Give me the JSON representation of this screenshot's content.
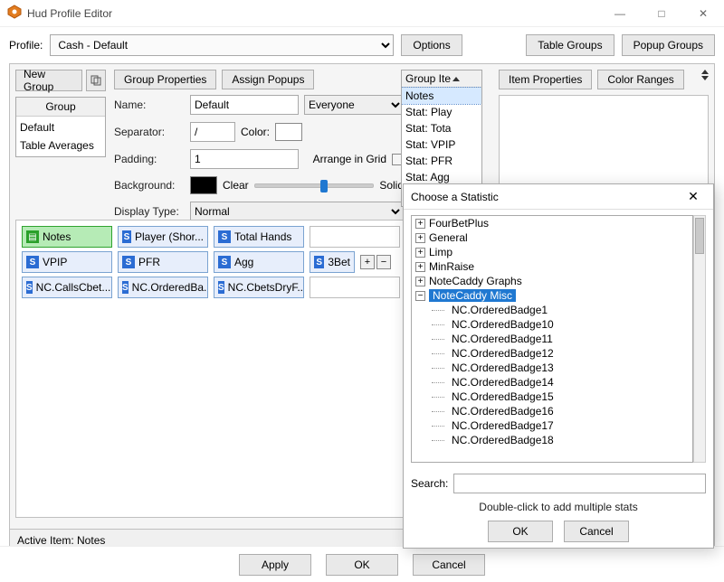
{
  "window": {
    "title": "Hud Profile Editor"
  },
  "profile": {
    "label": "Profile:",
    "selected": "Cash - Default",
    "options_btn": "Options",
    "table_groups": "Table Groups",
    "popup_groups": "Popup Groups"
  },
  "groups": {
    "new": "New Group",
    "header": "Group",
    "items": [
      "Default",
      "Table Averages"
    ]
  },
  "tabs": {
    "group_properties": "Group Properties",
    "assign_popups": "Assign Popups",
    "item_properties": "Item Properties",
    "color_ranges": "Color Ranges"
  },
  "props": {
    "name_lbl": "Name:",
    "name_val": "Default",
    "visibility": "Everyone",
    "sep_lbl": "Separator:",
    "sep_val": "/",
    "color_lbl": "Color:",
    "pad_lbl": "Padding:",
    "pad_val": "1",
    "arrange_lbl": "Arrange in Grid",
    "bg_lbl": "Background:",
    "clear": "Clear",
    "solid": "Solid",
    "disp_lbl": "Display Type:",
    "disp_val": "Normal"
  },
  "group_items": {
    "header": "Group Ite",
    "rows": [
      "Notes",
      "Stat: Play",
      "Stat: Tota",
      "Stat: VPIP",
      "Stat: PFR",
      "Stat: Agg"
    ]
  },
  "grid": {
    "r0": [
      "Notes",
      "Player (Shor...",
      "Total Hands"
    ],
    "r1": [
      "VPIP",
      "PFR",
      "Agg",
      "3Bet"
    ],
    "r2": [
      "NC.CallsCbet...",
      "NC.OrderedBa...",
      "NC.CbetsDryF..."
    ]
  },
  "status": {
    "label": "Active Item: Notes"
  },
  "footer": {
    "apply": "Apply",
    "ok": "OK",
    "cancel": "Cancel"
  },
  "dlg": {
    "title": "Choose a Statistic",
    "tree_top": [
      "FourBetPlus",
      "General",
      "Limp",
      "MinRaise",
      "NoteCaddy Graphs"
    ],
    "expanded": "NoteCaddy Misc",
    "children": [
      "NC.OrderedBadge1",
      "NC.OrderedBadge10",
      "NC.OrderedBadge11",
      "NC.OrderedBadge12",
      "NC.OrderedBadge13",
      "NC.OrderedBadge14",
      "NC.OrderedBadge15",
      "NC.OrderedBadge16",
      "NC.OrderedBadge17",
      "NC.OrderedBadge18"
    ],
    "search_lbl": "Search:",
    "hint": "Double-click to add multiple stats",
    "ok": "OK",
    "cancel": "Cancel"
  }
}
